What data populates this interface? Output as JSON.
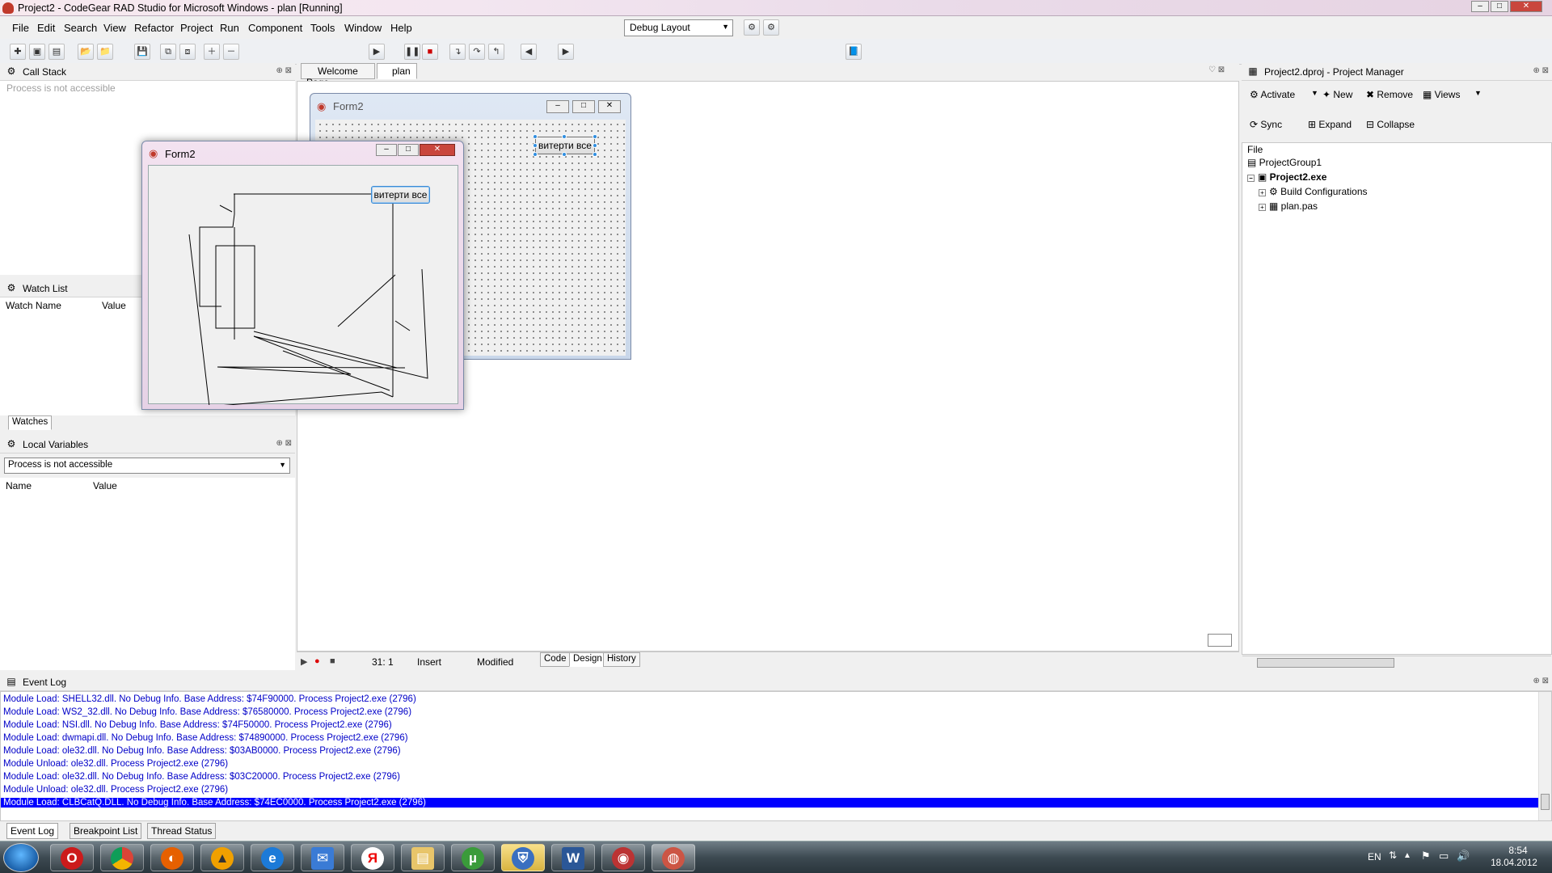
{
  "window": {
    "title": "Project2 - CodeGear RAD Studio for Microsoft Windows - plan [Running]",
    "min": "–",
    "max": "□",
    "close": "✕"
  },
  "menu": [
    "File",
    "Edit",
    "Search",
    "View",
    "Refactor",
    "Project",
    "Run",
    "Component",
    "Tools",
    "Window",
    "Help"
  ],
  "toolbar": {
    "layout_combo": "Debug Layout"
  },
  "call_stack": {
    "title": "Call Stack",
    "message": "Process is not accessible"
  },
  "watch_list": {
    "title": "Watch List",
    "col_name": "Watch Name",
    "col_value": "Value",
    "tab": "Watches"
  },
  "local_vars": {
    "title": "Local Variables",
    "combo": "Process is not accessible",
    "col_name": "Name",
    "col_value": "Value"
  },
  "editor": {
    "tabs": [
      "Welcome Page",
      "plan"
    ],
    "designer_form_title": "Form2",
    "designer_button": "витерти все",
    "status_pos": "31:  1",
    "status_mode": "Insert",
    "status_mod": "Modified",
    "bottom_tabs": [
      "Code",
      "Design",
      "History"
    ]
  },
  "running_form": {
    "title": "Form2",
    "button": "витерти все"
  },
  "project_manager": {
    "title": "Project2.dproj - Project Manager",
    "buttons": [
      "Activate",
      "New",
      "Remove",
      "Views"
    ],
    "buttons2": [
      "Sync",
      "Expand",
      "Collapse"
    ],
    "col": "File",
    "tree": {
      "group": "ProjectGroup1",
      "project": "Project2.exe",
      "build": "Build Configurations",
      "unit": "plan.pas"
    }
  },
  "event_log": {
    "title": "Event Log",
    "lines": [
      "Module Load: SHELL32.dll. No Debug Info. Base Address: $74F90000. Process Project2.exe (2796)",
      "Module Load: WS2_32.dll. No Debug Info. Base Address: $76580000. Process Project2.exe (2796)",
      "Module Load: NSI.dll. No Debug Info. Base Address: $74F50000. Process Project2.exe (2796)",
      "Module Load: dwmapi.dll. No Debug Info. Base Address: $74890000. Process Project2.exe (2796)",
      "Module Load: ole32.dll. No Debug Info. Base Address: $03AB0000. Process Project2.exe (2796)",
      "Module Unload: ole32.dll. Process Project2.exe (2796)",
      "Module Load: ole32.dll. No Debug Info. Base Address: $03C20000. Process Project2.exe (2796)",
      "Module Unload: ole32.dll. Process Project2.exe (2796)",
      "Module Load: CLBCatQ.DLL. No Debug Info. Base Address: $74EC0000. Process Project2.exe (2796)"
    ],
    "tabs": [
      "Event Log",
      "Breakpoint List",
      "Thread Status"
    ]
  },
  "taskbar": {
    "lang": "EN",
    "time": "8:54",
    "date": "18.04.2012"
  }
}
